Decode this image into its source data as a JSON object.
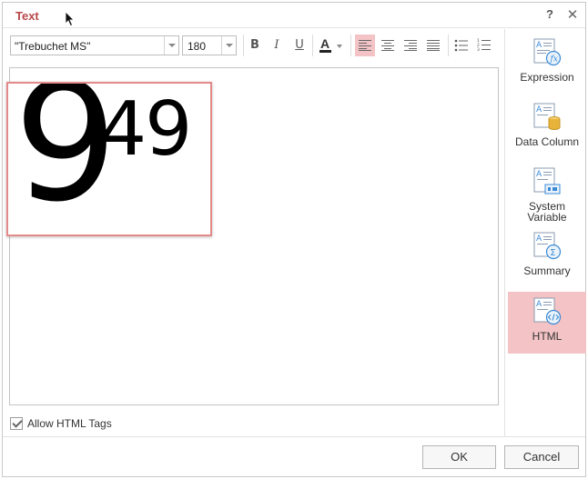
{
  "dialog": {
    "title": "Text",
    "help_label": "?",
    "close_label": "✕"
  },
  "toolbar": {
    "font_family": "\"Trebuchet MS\"",
    "font_size": "180",
    "bold_label": "B",
    "italic_label": "I",
    "underline_label": "U",
    "font_color_label": "A",
    "font_color": "#222222",
    "active_alignment": "left"
  },
  "editor": {
    "content_main": "9",
    "content_superscript": "49"
  },
  "options": {
    "allow_html_tags_label": "Allow HTML Tags",
    "allow_html_tags_checked": true
  },
  "right_panel": {
    "items": [
      {
        "label": "Expression",
        "icon": "expression-icon",
        "active": false
      },
      {
        "label": "Data Column",
        "icon": "data-column-icon",
        "active": false
      },
      {
        "label": "System\nVariable",
        "icon": "system-variable-icon",
        "active": false
      },
      {
        "label": "Summary",
        "icon": "summary-icon",
        "active": false
      },
      {
        "label": "HTML",
        "icon": "html-icon",
        "active": true
      }
    ]
  },
  "footer": {
    "ok_label": "OK",
    "cancel_label": "Cancel"
  },
  "colors": {
    "accent": "#b8474a",
    "active_bg": "#f3c3c5",
    "selection_border": "#e58a8a",
    "icon_blue": "#3a8ad4",
    "icon_gold": "#e8b339"
  }
}
